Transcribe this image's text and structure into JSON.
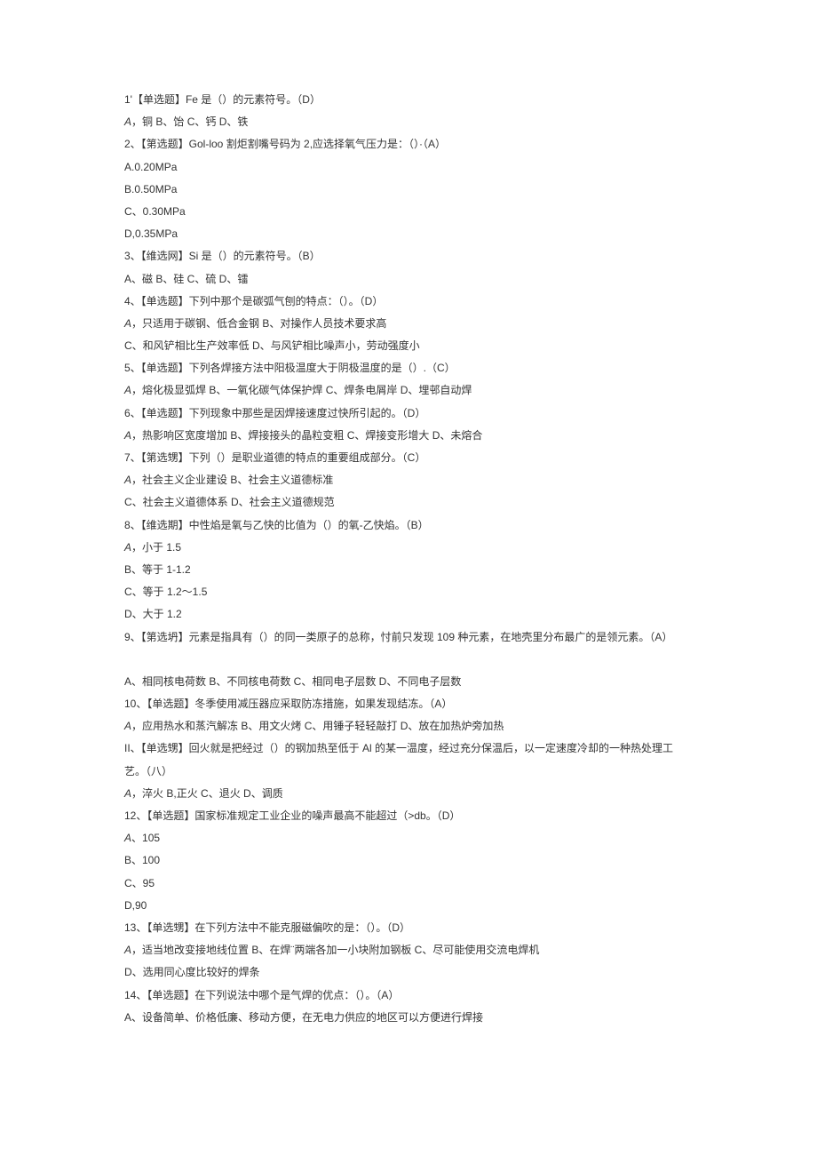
{
  "lines": [
    "1'【单选题】Fe 是（）的元素符号。（D）",
    "A，铜 B、饴 C、钙 D、铁",
    "2、【第选题】Gol-loo 割炬割嘴号码为 2,应选择氧气压力是：（）·（A）",
    "A.0.20MPa",
    "B.0.50MPa",
    "C、0.30MPa",
    "D,0.35MPa",
    "3、【维选网】Si 是（）的元素符号。（B）",
    "A、磁 B、硅 C、硫 D、镭",
    "4、【单选题】下列中那个是碳弧气刨的特点：（）。（D）",
    "A，只适用于碳钢、低合金钢 B、对操作人员技术要求高",
    "C、和风铲相比生产效率低 D、与风铲相比噪声小，劳动强度小",
    "5、【单选题】下列各焊接方法中阳极温度大于阴极温度的是（）.（C）",
    "A，熔化极显弧焊 B、一氧化碳气体保护焊 C、焊条电屑岸 D、埋邨自动焊",
    "6、【单选题】下列现象中那些是因焊接速度过快所引起的。（D）",
    "A，热影响区宽度增加 B、焊接接头的晶粒变粗 C、焊接变形增大 D、未熔合",
    "7、【第选甥】下列（）是职业道德的特点的重要组成部分。（C）",
    "A，社会主义企业建设 B、社会主义道德标准",
    "C、社会主义道德体系 D、社会主义道德规范",
    "8、【维选期】中性焰是氧与乙快的比值为（）的氧-乙快焰。（B）",
    "A，小于 1.5",
    "B、等于 1-1.2",
    "C、等于 1.2～1.5",
    "D、大于 1.2",
    "9、【第选坍】元素是指具有（）的同一类原子的总称，忖前只发现 109 种元素，在地壳里分布最广的是领元素。（A）",
    "",
    "A、相同核电荷数 B、不同核电荷数 C、相同电子层数 D、不同电子层数",
    "10、【单选题】冬季使用减压器应采取防冻措施，如果发现结冻。（A）",
    "A，应用热水和蒸汽解冻 B、用文火烤 C、用锤子轻轻敲打 D、放在加热炉旁加热",
    "II、【单选甥】回火就是把经过（）的钢加热至低于 Al 的某一温度，经过充分保温后，以一定速度冷却的一种热处理工艺。（八）",
    "A，淬火 B,正火 C、退火 D、调质",
    "12、【单选题】国家标准规定工业企业的噪声最高不能超过（>db。（D）",
    "A、105",
    "B、100",
    "C、95",
    "D,90",
    "13、【单选甥】在下列方法中不能克服磁偏吹的是：（）。（D）",
    "A，适当地改变接地线位置 B、在焊¨两端各加一小块附加钢板 C、尽可能使用交流电焊机",
    "D、选用同心度比较好的焊条",
    "14、【单选题】在下列说法中哪个是气焊的优点：（）。（A）",
    "A、设备简单、价格低廉、移动方便，在无电力供应的地区可以方便进行焊接"
  ],
  "italicIndices": [
    1,
    10,
    13,
    15,
    17,
    20,
    28,
    30,
    32,
    37
  ]
}
